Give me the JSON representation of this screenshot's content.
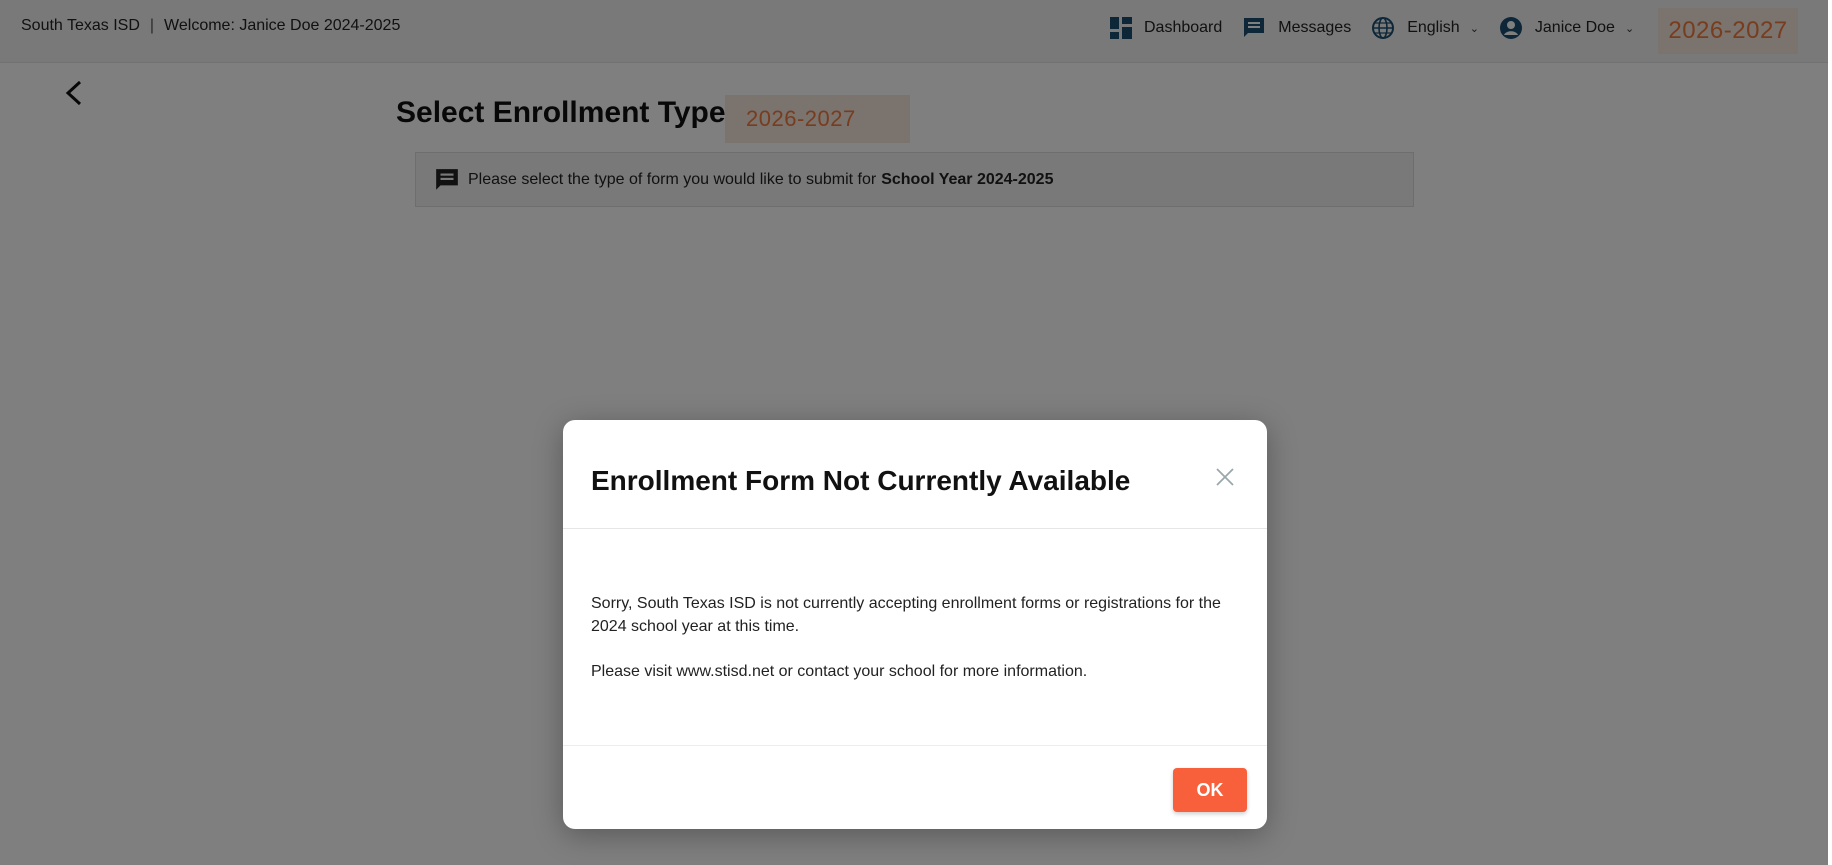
{
  "header": {
    "district": "South Texas ISD",
    "separator": "|",
    "welcome": "Welcome: Janice Doe 2024-2025",
    "dashboard": "Dashboard",
    "messages": "Messages",
    "language": "English",
    "user": "Janice Doe",
    "year_badge": "2026-2027"
  },
  "main": {
    "title": "Select Enrollment Type:",
    "year_badge": "2026-2027",
    "info_text": "Please select the type of form you would like to submit for",
    "info_bold": "School Year 2024-2025"
  },
  "modal": {
    "title": "Enrollment Form Not Currently Available",
    "paragraph1": "Sorry, South Texas ISD is not currently accepting enrollment forms or registrations for the 2024 school year at this time.",
    "paragraph2": "Please visit www.stisd.net or contact your school for more information.",
    "ok_label": "OK"
  },
  "colors": {
    "accent": "#f8603b",
    "badge_text": "#f07a3c",
    "badge_bg": "#f4e6dd",
    "icon_blue": "#1b4f72"
  }
}
